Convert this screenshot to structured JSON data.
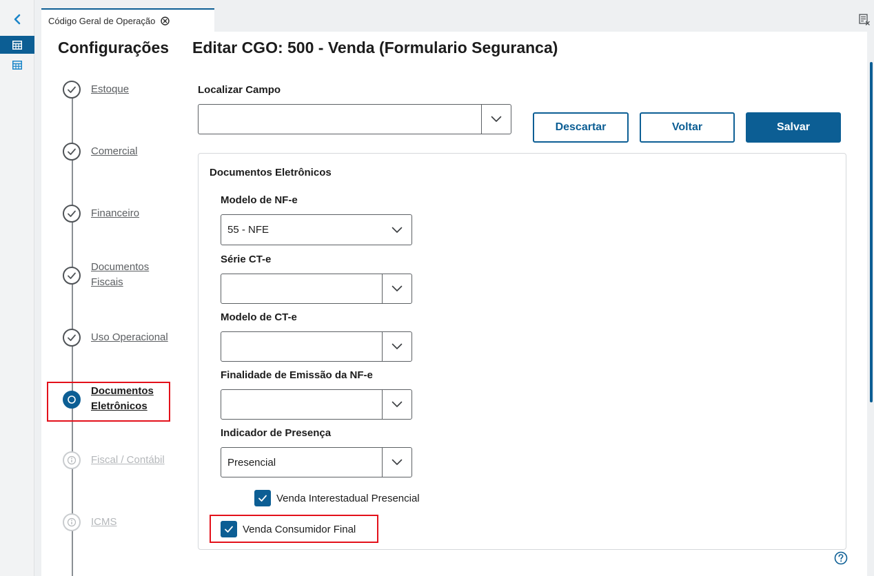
{
  "tab": {
    "title": "Código Geral de Operação"
  },
  "sidebar": {
    "title": "Configurações",
    "steps": [
      {
        "label": "Estoque",
        "state": "done"
      },
      {
        "label": "Comercial",
        "state": "done"
      },
      {
        "label": "Financeiro",
        "state": "done"
      },
      {
        "label_line1": "Documentos",
        "label_line2": "Fiscais",
        "state": "done"
      },
      {
        "label": "Uso Operacional",
        "state": "done"
      },
      {
        "label_line1": "Documentos",
        "label_line2": "Eletrônicos",
        "state": "current"
      },
      {
        "label": "Fiscal / Contábil",
        "state": "disabled"
      },
      {
        "label": "ICMS",
        "state": "disabled"
      }
    ]
  },
  "page": {
    "title": "Editar CGO: 500 - Venda (Formulario Seguranca)"
  },
  "search": {
    "label": "Localizar Campo",
    "value": ""
  },
  "actions": {
    "discard": "Descartar",
    "back": "Voltar",
    "save": "Salvar"
  },
  "section": {
    "title": "Documentos Eletrônicos",
    "fields": [
      {
        "label": "Modelo de NF-e",
        "value": "55 - NFE"
      },
      {
        "label": "Série CT-e",
        "value": ""
      },
      {
        "label": "Modelo de CT-e",
        "value": ""
      },
      {
        "label": "Finalidade de Emissão da NF-e",
        "value": ""
      },
      {
        "label": "Indicador de Presença",
        "value": "Presencial"
      }
    ],
    "checkboxes": [
      {
        "label": "Venda Interestadual Presencial",
        "checked": true
      },
      {
        "label": "Venda Consumidor Final",
        "checked": true
      }
    ]
  },
  "colors": {
    "primary": "#0c5e94",
    "highlight": "#e3101a"
  }
}
